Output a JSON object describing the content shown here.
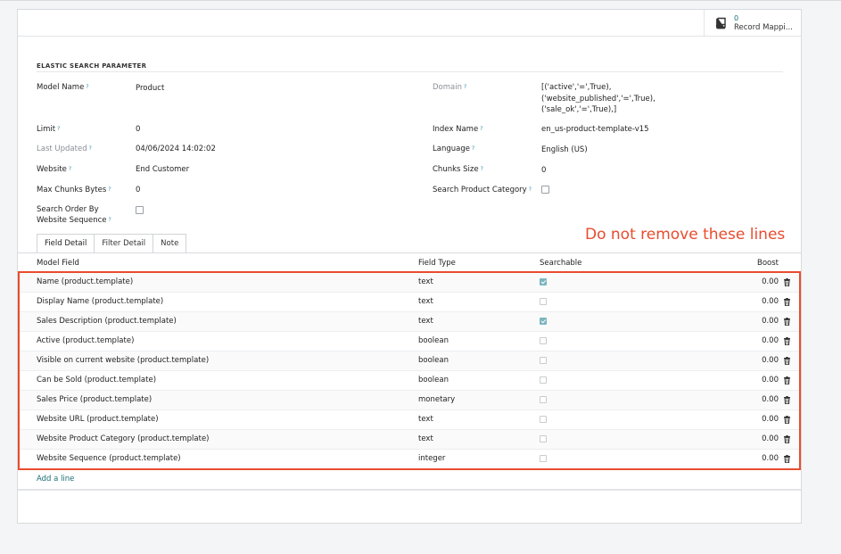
{
  "smart_button": {
    "count": "0",
    "label": "Record Mappi..."
  },
  "section": {
    "title": "ELASTIC SEARCH PARAMETER"
  },
  "help_mark": "?",
  "fields": {
    "model_name": {
      "label": "Model Name",
      "value": "Product"
    },
    "domain": {
      "label": "Domain",
      "lines": [
        "[('active','=',True),",
        "('website_published','=',True),",
        "('sale_ok','=',True),]"
      ]
    },
    "limit": {
      "label": "Limit",
      "value": "0"
    },
    "index_name": {
      "label": "Index Name",
      "value": "en_us-product-template-v15"
    },
    "last_updated": {
      "label": "Last Updated",
      "value": "04/06/2024 14:02:02"
    },
    "language": {
      "label": "Language",
      "value": "English (US)"
    },
    "website": {
      "label": "Website",
      "value": "End Customer"
    },
    "chunks_size": {
      "label": "Chunks Size",
      "value": "0"
    },
    "max_chunks_bytes": {
      "label": "Max Chunks Bytes",
      "value": "0"
    },
    "search_product_category": {
      "label": "Search Product Category",
      "checked": false
    },
    "search_order": {
      "label_line1": "Search Order By",
      "label_line2": "Website Sequence",
      "checked": false
    }
  },
  "tabs": [
    {
      "label": "Field Detail",
      "active": true
    },
    {
      "label": "Filter Detail",
      "active": false
    },
    {
      "label": "Note",
      "active": false
    }
  ],
  "annotation": "Do not remove these lines",
  "table": {
    "headers": {
      "model_field": "Model Field",
      "field_type": "Field Type",
      "searchable": "Searchable",
      "boost": "Boost"
    },
    "rows": [
      {
        "model_field": "Name (product.template)",
        "field_type": "text",
        "searchable": true,
        "boost": "0.00"
      },
      {
        "model_field": "Display Name (product.template)",
        "field_type": "text",
        "searchable": false,
        "boost": "0.00"
      },
      {
        "model_field": "Sales Description (product.template)",
        "field_type": "text",
        "searchable": true,
        "boost": "0.00"
      },
      {
        "model_field": "Active (product.template)",
        "field_type": "boolean",
        "searchable": false,
        "boost": "0.00"
      },
      {
        "model_field": "Visible on current website (product.template)",
        "field_type": "boolean",
        "searchable": false,
        "boost": "0.00"
      },
      {
        "model_field": "Can be Sold (product.template)",
        "field_type": "boolean",
        "searchable": false,
        "boost": "0.00"
      },
      {
        "model_field": "Sales Price (product.template)",
        "field_type": "monetary",
        "searchable": false,
        "boost": "0.00"
      },
      {
        "model_field": "Website URL (product.template)",
        "field_type": "text",
        "searchable": false,
        "boost": "0.00"
      },
      {
        "model_field": "Website Product Category (product.template)",
        "field_type": "text",
        "searchable": false,
        "boost": "0.00"
      },
      {
        "model_field": "Website Sequence (product.template)",
        "field_type": "integer",
        "searchable": false,
        "boost": "0.00"
      }
    ],
    "add_line": "Add a line"
  },
  "colors": {
    "accent": "#1a6e78",
    "annotation_red": "#e84c2f",
    "checked": "#7bb5bf"
  }
}
